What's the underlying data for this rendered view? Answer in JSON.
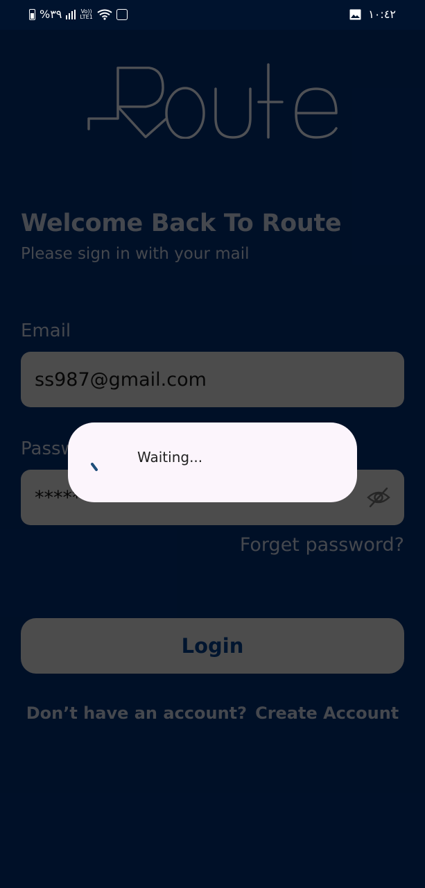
{
  "status_bar": {
    "battery_percent": "%٣٩",
    "network": "LTE1",
    "volte": "Vo))",
    "time": "١٠:٤٢"
  },
  "app": {
    "logo_text": "Route",
    "welcome_title": "Welcome Back To Route",
    "subtitle": "Please sign in with your mail"
  },
  "form": {
    "email_label": "Email",
    "email_value": "ss987@gmail.com",
    "password_label": "Password",
    "password_value": "********",
    "forgot_link": "Forget password?",
    "login_button": "Login",
    "no_account_text": "Don’t have an account?",
    "create_account_link": "Create Account"
  },
  "dialog": {
    "message": "Waiting..."
  },
  "colors": {
    "background": "#00193d",
    "field": "#757575",
    "muted_text": "#6b6f78",
    "dialog": "#fcf5fc"
  }
}
